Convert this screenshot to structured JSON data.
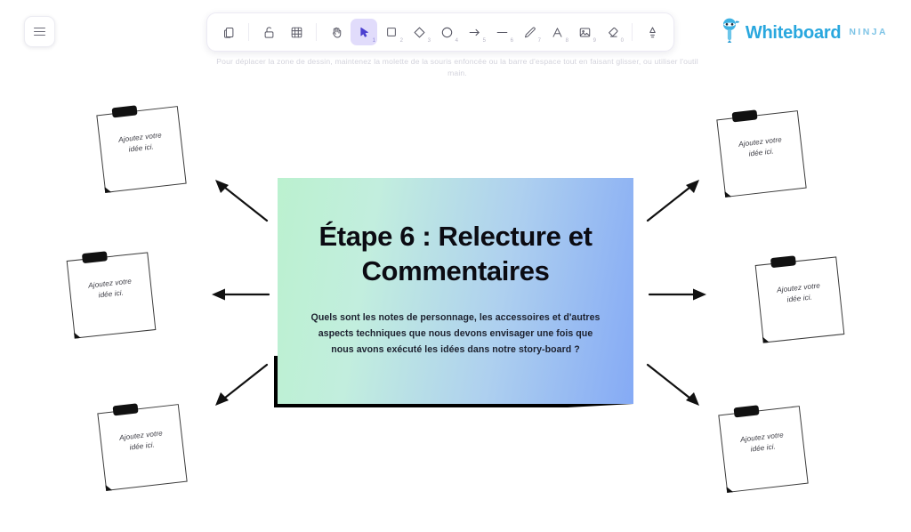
{
  "app": {
    "logo_name": "Whiteboard",
    "logo_sub": "NINJA",
    "logo_icon": "ninja-icon",
    "brand_color": "#29a7de"
  },
  "menu": {
    "label": "Menu",
    "icon": "hamburger-icon"
  },
  "toolbar": {
    "tools": [
      {
        "name": "clipboard-tool",
        "icon": "clipboard-icon",
        "shortcut": "",
        "active": false
      },
      {
        "name": "lock-tool",
        "icon": "lock-open-icon",
        "shortcut": "",
        "active": false
      },
      {
        "name": "grid-tool",
        "icon": "grid-icon",
        "shortcut": "",
        "active": false
      },
      {
        "name": "hand-tool",
        "icon": "hand-icon",
        "shortcut": "",
        "active": false
      },
      {
        "name": "select-tool",
        "icon": "cursor-arrow-icon",
        "shortcut": "1",
        "active": true
      },
      {
        "name": "rectangle-tool",
        "icon": "square-icon",
        "shortcut": "2",
        "active": false
      },
      {
        "name": "diamond-tool",
        "icon": "diamond-icon",
        "shortcut": "3",
        "active": false
      },
      {
        "name": "ellipse-tool",
        "icon": "circle-icon",
        "shortcut": "4",
        "active": false
      },
      {
        "name": "arrow-tool",
        "icon": "arrow-icon",
        "shortcut": "5",
        "active": false
      },
      {
        "name": "line-tool",
        "icon": "line-icon",
        "shortcut": "6",
        "active": false
      },
      {
        "name": "draw-tool",
        "icon": "pencil-icon",
        "shortcut": "7",
        "active": false
      },
      {
        "name": "text-tool",
        "icon": "text-a-icon",
        "shortcut": "8",
        "active": false
      },
      {
        "name": "image-tool",
        "icon": "image-icon",
        "shortcut": "9",
        "active": false
      },
      {
        "name": "eraser-tool",
        "icon": "eraser-icon",
        "shortcut": "0",
        "active": false
      },
      {
        "name": "laser-tool",
        "icon": "laser-pointer-icon",
        "shortcut": "",
        "active": false
      }
    ]
  },
  "hint": {
    "text": "Pour déplacer la zone de dessin, maintenez la molette de la souris enfoncée ou la barre d'espace tout en faisant glisser, ou utiliser l'outil main."
  },
  "card": {
    "title": "Étape 6 : Relecture et Commentaires",
    "body": "Quels sont les notes de personnage, les accessoires et d'autres aspects techniques que nous devons envisager une fois que nous avons exécuté les idées dans notre story-board ?",
    "gradient_start": "#bbf1cf",
    "gradient_end": "#85aaf5"
  },
  "notes": [
    {
      "id": "note-top-left",
      "text": "Ajoutez votre idée ici."
    },
    {
      "id": "note-middle-left",
      "text": "Ajoutez votre idée ici."
    },
    {
      "id": "note-bottom-left",
      "text": "Ajoutez votre idée ici."
    },
    {
      "id": "note-top-right",
      "text": "Ajoutez votre idée ici."
    },
    {
      "id": "note-middle-right",
      "text": "Ajoutez votre idée ici."
    },
    {
      "id": "note-bottom-right",
      "text": "Ajoutez votre idée ici."
    }
  ],
  "connectors": [
    {
      "id": "arrow-up-left",
      "direction": "up-left"
    },
    {
      "id": "arrow-left",
      "direction": "left"
    },
    {
      "id": "arrow-down-left",
      "direction": "down-left"
    },
    {
      "id": "arrow-up-right",
      "direction": "up-right"
    },
    {
      "id": "arrow-right",
      "direction": "right"
    },
    {
      "id": "arrow-down-right",
      "direction": "down-right"
    }
  ]
}
